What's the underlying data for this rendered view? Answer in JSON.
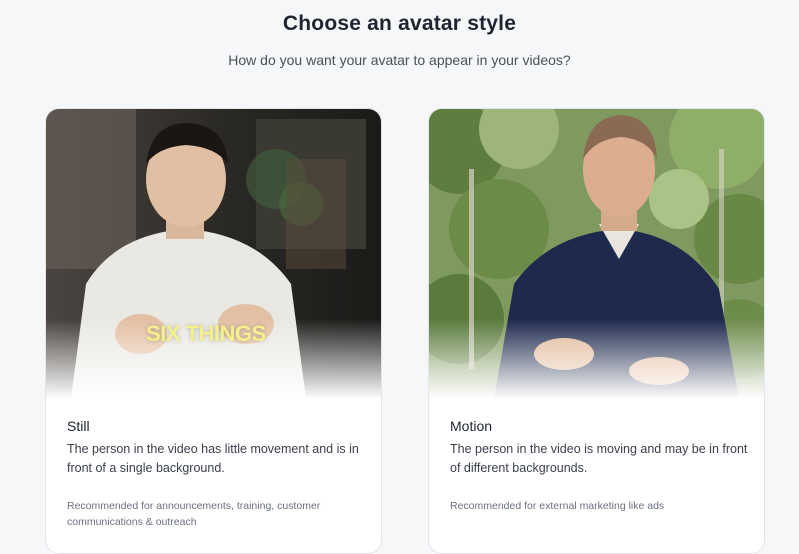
{
  "header": {
    "title": "Choose an avatar style",
    "subtitle": "How do you want your avatar to appear in your videos?"
  },
  "cards": [
    {
      "title": "Still",
      "description": "The person in the video has little movement and is in front of a single background.",
      "recommendation": "Recommended for announcements, training, customer communications & outreach",
      "overlay_text": "SIX THINGS"
    },
    {
      "title": "Motion",
      "description": "The person in the video is moving and may be in front of different backgrounds.",
      "recommendation": "Recommended for external marketing like ads"
    }
  ]
}
